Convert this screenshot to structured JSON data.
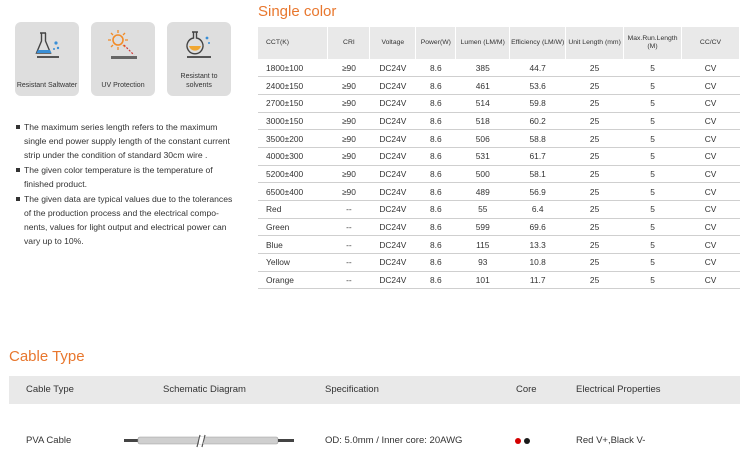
{
  "features": [
    {
      "label": "Resistant Saltwater",
      "icon": "flask-saltwater-icon"
    },
    {
      "label": "UV Protection",
      "icon": "sun-uv-icon"
    },
    {
      "label": "Resistant to solvents",
      "icon": "flask-solvent-icon"
    }
  ],
  "notes": [
    "The maximum series length refers to the maximum single end power supply length of the constant current strip under the condition of standard 30cm wire .",
    "The given color temperature is the temperature of finished product.",
    "The given data are typical values due to the tolerances of the production process and the electrical compo-nents, values for light output and electrical power can vary up to 10%."
  ],
  "section_title": "Single color",
  "table": {
    "headers": [
      "CCT(K)",
      "CRI",
      "Voltage",
      "Power(W)",
      "Lumen (LM/M)",
      "Efficiency (LM/W)",
      "Unit Length (mm)",
      "Max.Run.Length (M)",
      "CC/CV"
    ],
    "rows": [
      [
        "1800±100",
        "≥90",
        "DC24V",
        "8.6",
        "385",
        "44.7",
        "25",
        "5",
        "CV"
      ],
      [
        "2400±150",
        "≥90",
        "DC24V",
        "8.6",
        "461",
        "53.6",
        "25",
        "5",
        "CV"
      ],
      [
        "2700±150",
        "≥90",
        "DC24V",
        "8.6",
        "514",
        "59.8",
        "25",
        "5",
        "CV"
      ],
      [
        "3000±150",
        "≥90",
        "DC24V",
        "8.6",
        "518",
        "60.2",
        "25",
        "5",
        "CV"
      ],
      [
        "3500±200",
        "≥90",
        "DC24V",
        "8.6",
        "506",
        "58.8",
        "25",
        "5",
        "CV"
      ],
      [
        "4000±300",
        "≥90",
        "DC24V",
        "8.6",
        "531",
        "61.7",
        "25",
        "5",
        "CV"
      ],
      [
        "5200±400",
        "≥90",
        "DC24V",
        "8.6",
        "500",
        "58.1",
        "25",
        "5",
        "CV"
      ],
      [
        "6500±400",
        "≥90",
        "DC24V",
        "8.6",
        "489",
        "56.9",
        "25",
        "5",
        "CV"
      ],
      [
        "Red",
        "--",
        "DC24V",
        "8.6",
        "55",
        "6.4",
        "25",
        "5",
        "CV"
      ],
      [
        "Green",
        "--",
        "DC24V",
        "8.6",
        "599",
        "69.6",
        "25",
        "5",
        "CV"
      ],
      [
        "Blue",
        "--",
        "DC24V",
        "8.6",
        "115",
        "13.3",
        "25",
        "5",
        "CV"
      ],
      [
        "Yellow",
        "--",
        "DC24V",
        "8.6",
        "93",
        "10.8",
        "25",
        "5",
        "CV"
      ],
      [
        "Orange",
        "--",
        "DC24V",
        "8.6",
        "101",
        "11.7",
        "25",
        "5",
        "CV"
      ]
    ]
  },
  "cable": {
    "title": "Cable Type",
    "headers": {
      "type": "Cable Type",
      "diagram": "Schematic Diagram",
      "spec": "Specification",
      "core": "Core",
      "electrical": "Electrical Properties"
    },
    "row": {
      "type": "PVA Cable",
      "spec": "OD: 5.0mm / Inner core: 20AWG",
      "electrical": "Red V+,Black V-",
      "core_colors": [
        "#d40000",
        "#1a1a1a"
      ]
    }
  },
  "colors": {
    "accent": "#e8772e",
    "header_bg": "#e9e9e9",
    "card_bg": "#dedede"
  }
}
